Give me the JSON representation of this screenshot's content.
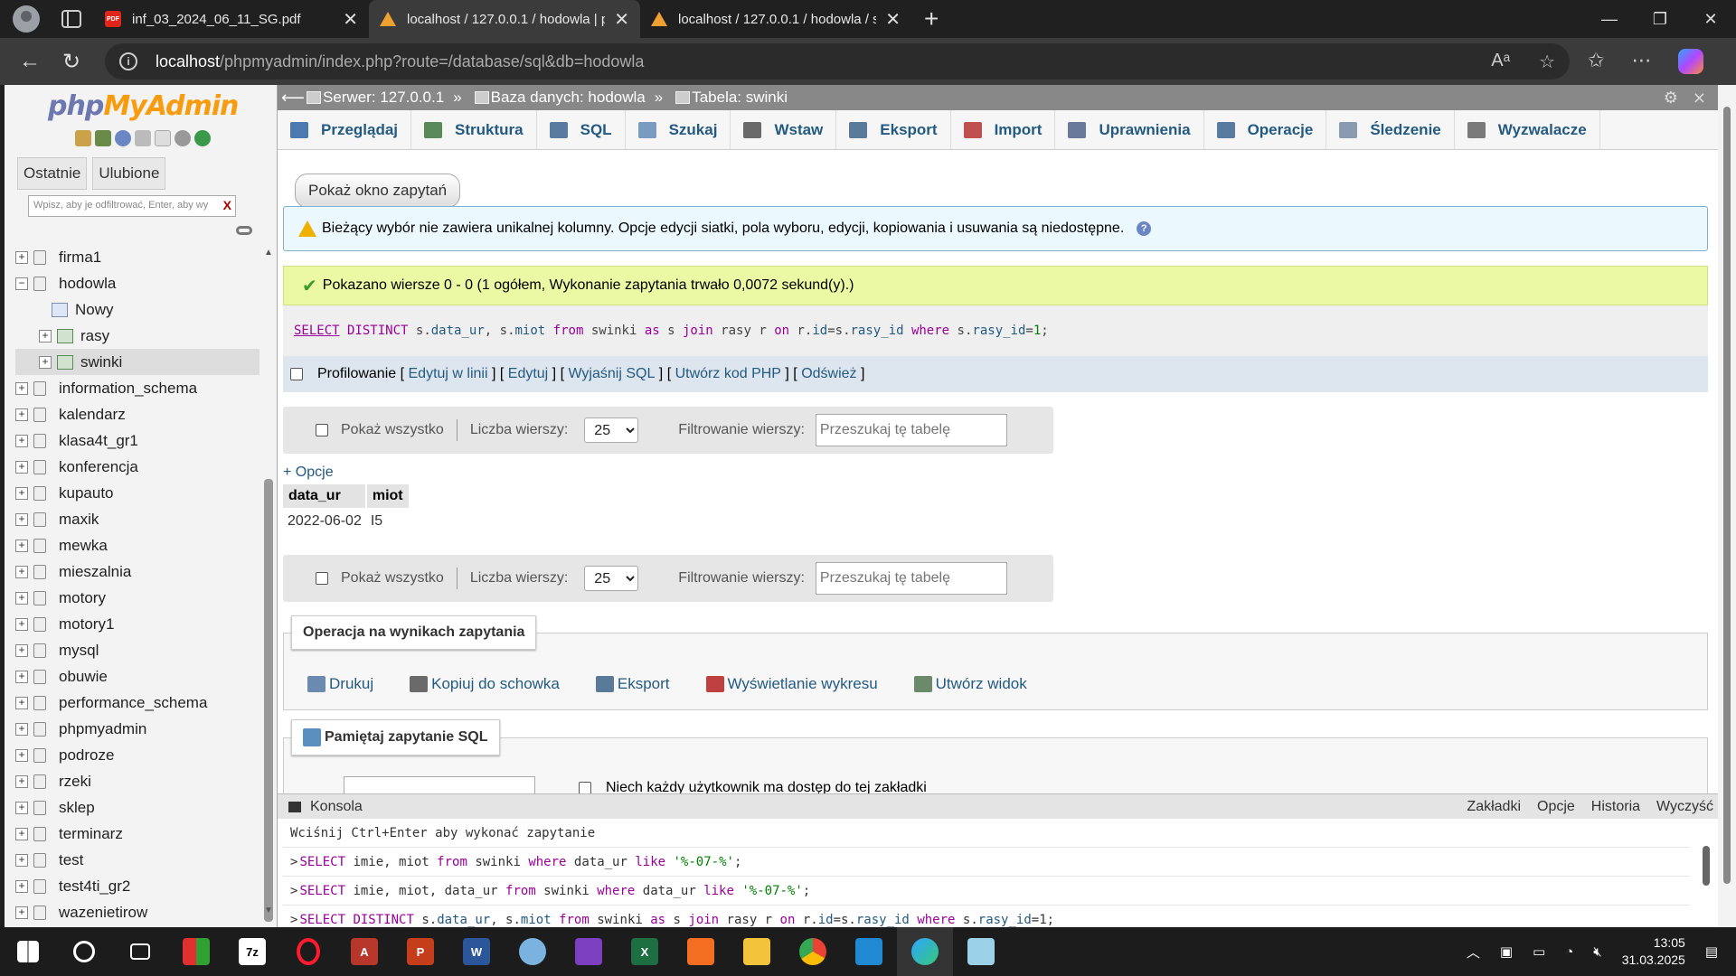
{
  "browser": {
    "tabs": [
      {
        "title": "inf_03_2024_06_11_SG.pdf"
      },
      {
        "title": "localhost / 127.0.0.1 / hodowla | p"
      },
      {
        "title": "localhost / 127.0.0.1 / hodowla / s"
      }
    ],
    "url_host": "localhost",
    "url_path": "/phpmyadmin/index.php?route=/database/sql&db=hodowla"
  },
  "sidebar": {
    "logo_php": "php",
    "logo_my": "My",
    "logo_admin": "Admin",
    "tab_recent": "Ostatnie",
    "tab_favorites": "Ulubione",
    "filter_placeholder": "Wpisz, aby je odfiltrować, Enter, aby wy",
    "filter_clear": "X",
    "databases": [
      {
        "name": "firma1"
      },
      {
        "name": "hodowla"
      },
      {
        "name": "information_schema"
      },
      {
        "name": "kalendarz"
      },
      {
        "name": "klasa4t_gr1"
      },
      {
        "name": "konferencja"
      },
      {
        "name": "kupauto"
      },
      {
        "name": "maxik"
      },
      {
        "name": "mewka"
      },
      {
        "name": "mieszalnia"
      },
      {
        "name": "motory"
      },
      {
        "name": "motory1"
      },
      {
        "name": "mysql"
      },
      {
        "name": "obuwie"
      },
      {
        "name": "performance_schema"
      },
      {
        "name": "phpmyadmin"
      },
      {
        "name": "podroze"
      },
      {
        "name": "rzeki"
      },
      {
        "name": "sklep"
      },
      {
        "name": "terminarz"
      },
      {
        "name": "test"
      },
      {
        "name": "test4ti_gr2"
      },
      {
        "name": "wazenietirow"
      }
    ],
    "hodowla_children": {
      "new": "Nowy",
      "tables": [
        "rasy",
        "swinki"
      ]
    }
  },
  "breadcrumb": {
    "server": "Serwer: 127.0.0.1",
    "database": "Baza danych: hodowla",
    "table": "Tabela: swinki",
    "sep": "»"
  },
  "tabs": [
    {
      "label": "Przeglądaj",
      "color": "#4a7ab0"
    },
    {
      "label": "Struktura",
      "color": "#5a8a5a"
    },
    {
      "label": "SQL",
      "color": "#5a7aa0"
    },
    {
      "label": "Szukaj",
      "color": "#7a9ac0"
    },
    {
      "label": "Wstaw",
      "color": "#6a6a6a"
    },
    {
      "label": "Eksport",
      "color": "#5a7a9a"
    },
    {
      "label": "Import",
      "color": "#c05050"
    },
    {
      "label": "Uprawnienia",
      "color": "#6a7a9a"
    },
    {
      "label": "Operacje",
      "color": "#5a7aa0"
    },
    {
      "label": "Śledzenie",
      "color": "#8a9ab0"
    },
    {
      "label": "Wyzwalacze",
      "color": "#7a7a7a"
    }
  ],
  "query_window_button": "Pokaż okno zapytań",
  "notice": "Bieżący wybór nie zawiera unikalnej kolumny. Opcje edycji siatki, pola wyboru, edycji, kopiowania i usuwania są niedostępne.",
  "success": "Pokazano wiersze 0 - 0 (1 ogółem, Wykonanie zapytania trwało 0,0072 sekund(y).)",
  "sql_tokens": {
    "select": "SELECT",
    "distinct": "DISTINCT",
    "s1": "s.",
    "c1": "data_ur",
    "comma": ",",
    "s2": "s.",
    "c2": "miot",
    "from": "from",
    "t1": "swinki",
    "as": "as",
    "alias1": "s",
    "join": "join",
    "t2": "rasy",
    "alias2": "r",
    "on": "on",
    "r1": "r.",
    "c3": "id",
    "eq1": "=",
    "s3": "s.",
    "c4": "rasy_id",
    "where": "where",
    "s4": "s.",
    "c5": "rasy_id",
    "eq2": "=",
    "n1": "1",
    "semi": ";"
  },
  "profiling": {
    "label": "Profilowanie",
    "links": [
      "Edytuj w linii",
      "Edytuj",
      "Wyjaśnij SQL",
      "Utwórz kod PHP",
      "Odśwież"
    ]
  },
  "nav": {
    "show_all": "Pokaż wszystko",
    "row_count_label": "Liczba wierszy:",
    "row_count_value": "25",
    "filter_label": "Filtrowanie wierszy:",
    "filter_placeholder": "Przeszukaj tę tabelę"
  },
  "options_link": "+ Opcje",
  "result": {
    "columns": [
      "data_ur",
      "miot"
    ],
    "rows": [
      [
        "2022-06-02",
        "I5"
      ]
    ]
  },
  "operations": {
    "title": "Operacja na wynikach zapytania",
    "items": [
      {
        "label": "Drukuj",
        "color": "#6a8ab0"
      },
      {
        "label": "Kopiuj do schowka",
        "color": "#6a6a6a"
      },
      {
        "label": "Eksport",
        "color": "#5a7a9a"
      },
      {
        "label": "Wyświetlanie wykresu",
        "color": "#c04040"
      },
      {
        "label": "Utwórz widok",
        "color": "#6a8a6a"
      }
    ]
  },
  "bookmark": {
    "title": "Pamiętaj zapytanie SQL",
    "shared_label": "Niech każdy użytkownik ma dostęp do tej zakładki"
  },
  "console": {
    "title": "Konsola",
    "actions": [
      "Zakładki",
      "Opcje",
      "Historia",
      "Wyczyść"
    ],
    "hint": "Wciśnij Ctrl+Enter aby wykonać zapytanie",
    "prompt": ">"
  },
  "taskbar": {
    "time": "13:05",
    "date": "31.03.2025"
  }
}
